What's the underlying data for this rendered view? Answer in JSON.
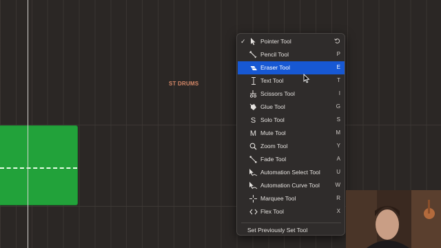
{
  "track": {
    "label": "ST DRUMS"
  },
  "menu": {
    "items": [
      {
        "label": "Pointer Tool",
        "shortcut": "",
        "icon": "arrow-pointer-icon",
        "checked": true
      },
      {
        "label": "Pencil Tool",
        "shortcut": "P",
        "icon": "pencil-icon"
      },
      {
        "label": "Eraser Tool",
        "shortcut": "E",
        "icon": "eraser-icon",
        "selected": true
      },
      {
        "label": "Text Tool",
        "shortcut": "T",
        "icon": "text-cursor-icon"
      },
      {
        "label": "Scissors Tool",
        "shortcut": "I",
        "icon": "scissors-icon"
      },
      {
        "label": "Glue Tool",
        "shortcut": "G",
        "icon": "glue-icon"
      },
      {
        "label": "Solo Tool",
        "shortcut": "S",
        "icon": "solo-icon"
      },
      {
        "label": "Mute Tool",
        "shortcut": "M",
        "icon": "mute-icon"
      },
      {
        "label": "Zoom Tool",
        "shortcut": "Y",
        "icon": "zoom-icon"
      },
      {
        "label": "Fade Tool",
        "shortcut": "A",
        "icon": "fade-icon"
      },
      {
        "label": "Automation Select Tool",
        "shortcut": "U",
        "icon": "automation-select-icon"
      },
      {
        "label": "Automation Curve Tool",
        "shortcut": "W",
        "icon": "automation-curve-icon"
      },
      {
        "label": "Marquee Tool",
        "shortcut": "R",
        "icon": "marquee-crosshair-icon"
      },
      {
        "label": "Flex Tool",
        "shortcut": "X",
        "icon": "flex-icon"
      }
    ],
    "footer": "Set Previously Set Tool",
    "checkmark": "✓"
  },
  "colors": {
    "selection": "#1758d3",
    "region": "#22a23a",
    "track_label": "#d58868"
  }
}
